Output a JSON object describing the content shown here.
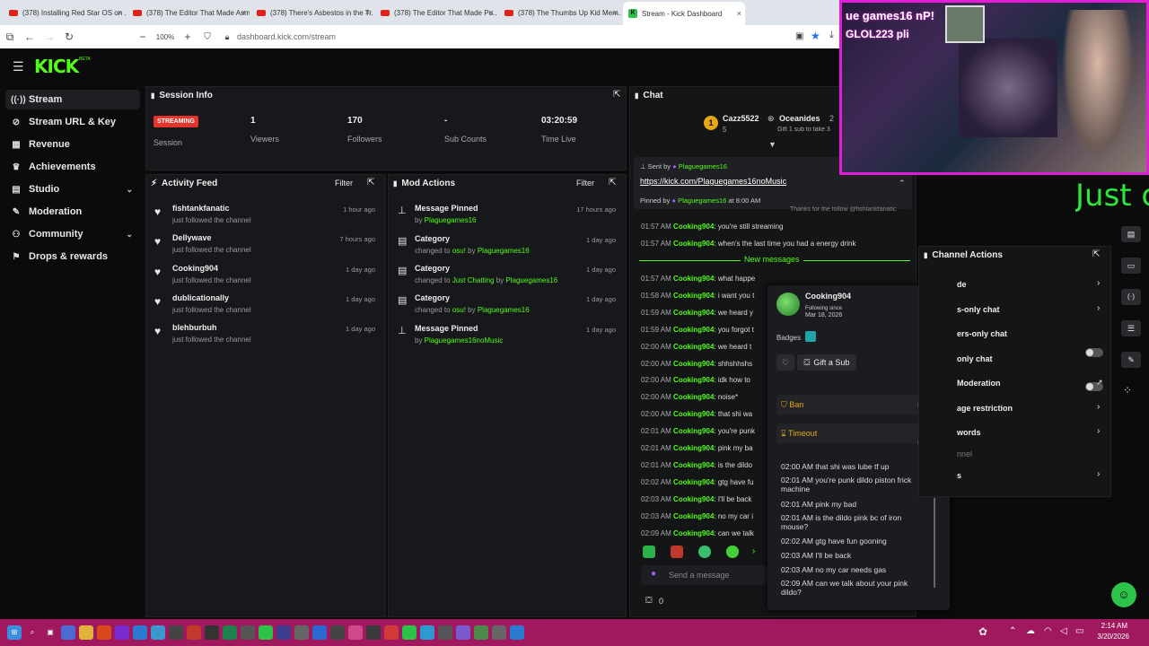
{
  "browser": {
    "tabs": [
      "(378) Installing Red Star OS on ...",
      "(378) The Editor That Made Asm...",
      "(378) There's Asbestos in the Tr...",
      "(378) The Editor That Made Pu...",
      "(378) The Thumbs Up Kid Mem...",
      "Stream - Kick Dashboard"
    ],
    "zoom": "100%",
    "url": "dashboard.kick.com/stream"
  },
  "logo": {
    "text": "KICK",
    "badge": "BETA"
  },
  "sidebar": {
    "items": [
      {
        "label": "Stream",
        "icon": "stream-icon"
      },
      {
        "label": "Stream URL & Key",
        "icon": "link-icon"
      },
      {
        "label": "Revenue",
        "icon": "revenue-icon"
      },
      {
        "label": "Achievements",
        "icon": "trophy-icon"
      },
      {
        "label": "Studio",
        "icon": "grid-icon"
      },
      {
        "label": "Moderation",
        "icon": "wrench-icon"
      },
      {
        "label": "Community",
        "icon": "community-icon"
      },
      {
        "label": "Drops & rewards",
        "icon": "gift-icon"
      }
    ]
  },
  "session": {
    "title": "Session Info",
    "status": "STREAMING",
    "status_label": "Session",
    "stats": [
      {
        "value": "1",
        "label": "Viewers"
      },
      {
        "value": "170",
        "label": "Followers"
      },
      {
        "value": "-",
        "label": "Sub Counts"
      },
      {
        "value": "03:20:59",
        "label": "Time Live"
      }
    ]
  },
  "activity": {
    "title": "Activity Feed",
    "filter": "Filter",
    "items": [
      {
        "name": "fishtankfanatic",
        "sub": "just followed the channel",
        "time": "1 hour ago"
      },
      {
        "name": "Dellywave",
        "sub": "just followed the channel",
        "time": "7 hours ago"
      },
      {
        "name": "Cooking904",
        "sub": "just followed the channel",
        "time": "1 day ago"
      },
      {
        "name": "dublicationally",
        "sub": "just followed the channel",
        "time": "1 day ago"
      },
      {
        "name": "blehburbuh",
        "sub": "just followed the channel",
        "time": "1 day ago"
      }
    ]
  },
  "mod": {
    "title": "Mod Actions",
    "filter": "Filter",
    "items": [
      {
        "title": "Message Pinned",
        "pre": "by ",
        "a": "Plaguegames16",
        "mid": "",
        "b": "",
        "time": "17 hours ago"
      },
      {
        "title": "Category",
        "pre": "changed to ",
        "a": "osu!",
        "mid": " by ",
        "b": "Plaguegames16",
        "time": "1 day ago"
      },
      {
        "title": "Category",
        "pre": "changed to ",
        "a": "Just Chatting",
        "mid": " by ",
        "b": "Plaguegames16",
        "time": "1 day ago"
      },
      {
        "title": "Category",
        "pre": "changed to ",
        "a": "osu!",
        "mid": " by ",
        "b": "Plaguegames16",
        "time": "1 day ago"
      },
      {
        "title": "Message Pinned",
        "pre": "by ",
        "a": "Plaguegames16noMusic",
        "mid": "",
        "b": "",
        "time": "1 day ago"
      }
    ]
  },
  "chat": {
    "title": "Chat",
    "leader1": {
      "rank": "1",
      "name": "Cazz5522",
      "count": "5"
    },
    "leader2": {
      "name": "Oceanides",
      "count": "2",
      "sub": "Gift 1 sub to take 3"
    },
    "pinned": {
      "sent_by": "Sent by",
      "sender": "Plaguegames16",
      "link": "https://kick.com/Plaguegames16noMusic",
      "pinned_by": "Pinned by",
      "pinner": "Plaguegames16",
      "at": "at 8:00 AM"
    },
    "partial": "Thanks for the follow @fishtankfanatic",
    "lines": [
      {
        "time": "01:57 AM",
        "user": "Cooking904",
        "text": "you're still streaming"
      },
      {
        "time": "01:57 AM",
        "user": "Cooking904",
        "text": "when's the last time you had a energy drink"
      }
    ],
    "new_messages": "New messages",
    "lines2": [
      {
        "time": "01:57 AM",
        "user": "Cooking904",
        "text": "what happe"
      },
      {
        "time": "01:58 AM",
        "user": "Cooking904",
        "text": "i want you t"
      },
      {
        "time": "01:59 AM",
        "user": "Cooking904",
        "text": "we heard y"
      },
      {
        "time": "01:59 AM",
        "user": "Cooking904",
        "text": "you forgot t"
      },
      {
        "time": "02:00 AM",
        "user": "Cooking904",
        "text": "we heard t"
      },
      {
        "time": "02:00 AM",
        "user": "Cooking904",
        "text": "shhshhshs"
      },
      {
        "time": "02:00 AM",
        "user": "Cooking904",
        "text": "idk how to"
      },
      {
        "time": "02:00 AM",
        "user": "Cooking904",
        "text": "noise*"
      },
      {
        "time": "02:00 AM",
        "user": "Cooking904",
        "text": "that shi wa"
      },
      {
        "time": "02:01 AM",
        "user": "Cooking904",
        "text": "you're punk"
      },
      {
        "time": "02:01 AM",
        "user": "Cooking904",
        "text": "pink my ba"
      },
      {
        "time": "02:01 AM",
        "user": "Cooking904",
        "text": "is the dildo"
      },
      {
        "time": "02:02 AM",
        "user": "Cooking904",
        "text": "gtg have fu"
      },
      {
        "time": "02:03 AM",
        "user": "Cooking904",
        "text": "I'll be back"
      },
      {
        "time": "02:03 AM",
        "user": "Cooking904",
        "text": "no my car i"
      },
      {
        "time": "02:09 AM",
        "user": "Cooking904",
        "text": "can we talk"
      }
    ],
    "placeholder": "Send a message",
    "count": "0"
  },
  "usercard": {
    "name": "Cooking904",
    "following": "Following since",
    "date": "Mar 18, 2026",
    "badges": "Badges",
    "gift": "Gift a Sub",
    "ban": "Ban",
    "timeout": "Timeout",
    "history": [
      "02:00 AM that shi was lube tf up",
      "02:01 AM you're punk dildo piston frick machine",
      "02:01 AM pink my bad",
      "02:01 AM is the dildo pink bc of iron mouse?",
      "02:02 AM gtg have fun gooning",
      "02:03 AM I'll be back",
      "02:03 AM no my car needs gas",
      "02:09 AM can we talk about your pink dildo?"
    ]
  },
  "channel_actions": {
    "title": "Channel Actions",
    "items": [
      "de",
      "s-only chat",
      "ers-only chat",
      "only chat",
      "Moderation",
      "age restriction",
      "words",
      "nnel",
      "s"
    ]
  },
  "webcam": {
    "overlay1": "ue games16 nP!",
    "overlay2": "GLOL223 pli"
  },
  "stream_text": "Just c",
  "taskbar": {
    "time": "2:14 AM",
    "date": "3/20/2026"
  }
}
